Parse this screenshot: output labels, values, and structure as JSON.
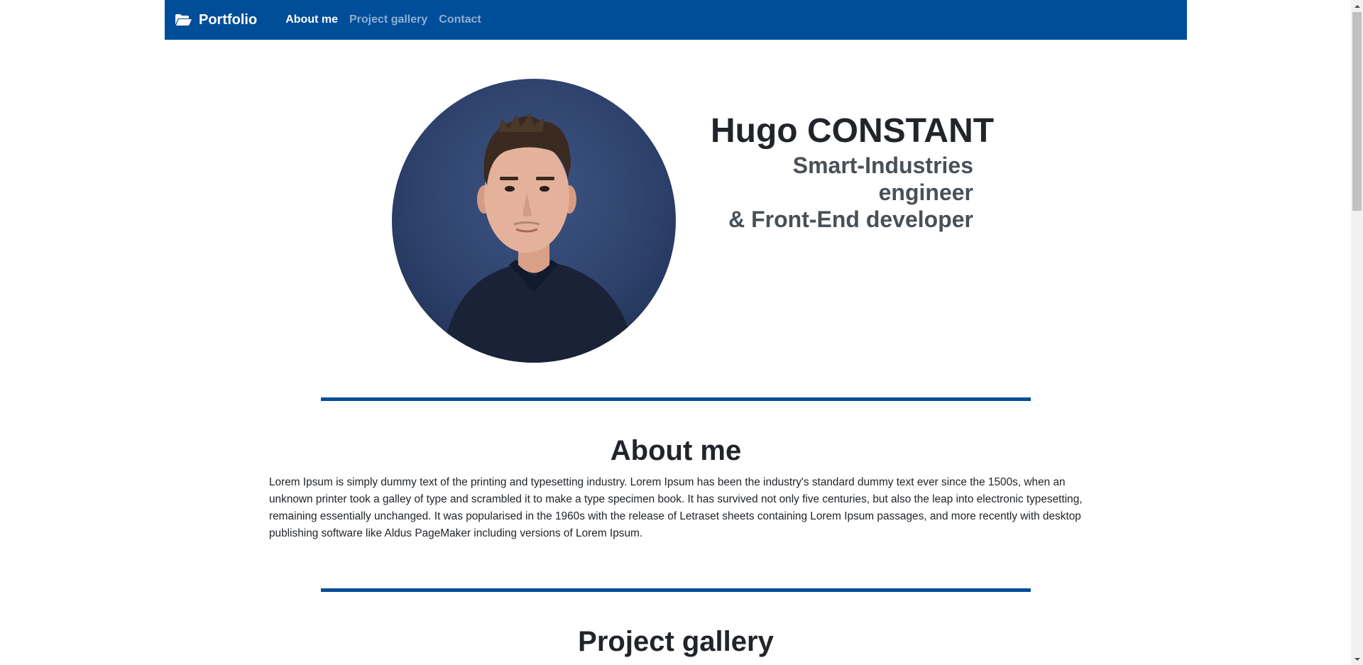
{
  "navbar": {
    "brand_icon": "folder-open-icon",
    "brand_label": "Portfolio",
    "links": [
      {
        "label": "About me",
        "active": true
      },
      {
        "label": "Project gallery",
        "active": false
      },
      {
        "label": "Contact",
        "active": false
      }
    ],
    "background_color": "#004d99"
  },
  "hero": {
    "name": "Hugo CONSTANT",
    "subtitle_line1": "Smart-Industries engineer",
    "subtitle_line2": "& Front-End developer"
  },
  "about": {
    "title": "About me",
    "text": "Lorem Ipsum is simply dummy text of the printing and typesetting industry. Lorem Ipsum has been the industry's standard dummy text ever since the 1500s, when an unknown printer took a galley of type and scrambled it to make a type specimen book. It has survived not only five centuries, but also the leap into electronic typesetting, remaining essentially unchanged. It was popularised in the 1960s with the release of Letraset sheets containing Lorem Ipsum passages, and more recently with desktop publishing software like Aldus PageMaker including versions of Lorem Ipsum."
  },
  "gallery": {
    "title": "Project gallery"
  },
  "colors": {
    "accent": "#004d99"
  }
}
